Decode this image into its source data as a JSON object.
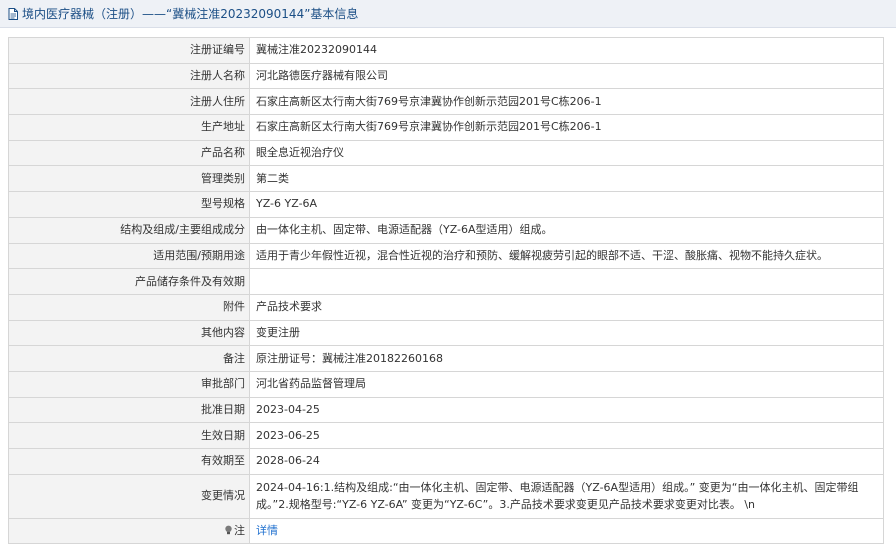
{
  "header": {
    "title": "境内医疗器械（注册）——“冀械注准20232090144”基本信息"
  },
  "rows": [
    {
      "label": "注册证编号",
      "value": "冀械注准20232090144"
    },
    {
      "label": "注册人名称",
      "value": "河北路德医疗器械有限公司"
    },
    {
      "label": "注册人住所",
      "value": "石家庄高新区太行南大街769号京津冀协作创新示范园201号C栋206-1"
    },
    {
      "label": "生产地址",
      "value": "石家庄高新区太行南大街769号京津冀协作创新示范园201号C栋206-1"
    },
    {
      "label": "产品名称",
      "value": "眼全息近视治疗仪"
    },
    {
      "label": "管理类别",
      "value": "第二类"
    },
    {
      "label": "型号规格",
      "value": "YZ-6 YZ-6A"
    },
    {
      "label": "结构及组成/主要组成成分",
      "value": "由一体化主机、固定带、电源适配器（YZ-6A型适用）组成。"
    },
    {
      "label": "适用范围/预期用途",
      "value": "适用于青少年假性近视，混合性近视的治疗和预防、缓解视疲劳引起的眼部不适、干涩、酸胀痛、视物不能持久症状。"
    },
    {
      "label": "产品储存条件及有效期",
      "value": ""
    },
    {
      "label": "附件",
      "value": "产品技术要求"
    },
    {
      "label": "其他内容",
      "value": "变更注册"
    },
    {
      "label": "备注",
      "value": "原注册证号：冀械注准20182260168"
    },
    {
      "label": "审批部门",
      "value": "河北省药品监督管理局"
    },
    {
      "label": "批准日期",
      "value": "2023-04-25"
    },
    {
      "label": "生效日期",
      "value": "2023-06-25"
    },
    {
      "label": "有效期至",
      "value": "2028-06-24"
    },
    {
      "label": "变更情况",
      "value": "2024-04-16:1.结构及组成:“由一体化主机、固定带、电源适配器（YZ-6A型适用）组成。” 变更为“由一体化主机、固定带组成。”2.规格型号:“YZ-6 YZ-6A” 变更为“YZ-6C”。3.产品技术要求变更见产品技术要求变更对比表。 \\n"
    }
  ],
  "note": {
    "label": "注",
    "value": "详情"
  },
  "colors": {
    "header_bg": "#eef1f6",
    "title": "#1c4f86",
    "label_bg": "#f3f3f3",
    "link": "#1e6fcf"
  }
}
